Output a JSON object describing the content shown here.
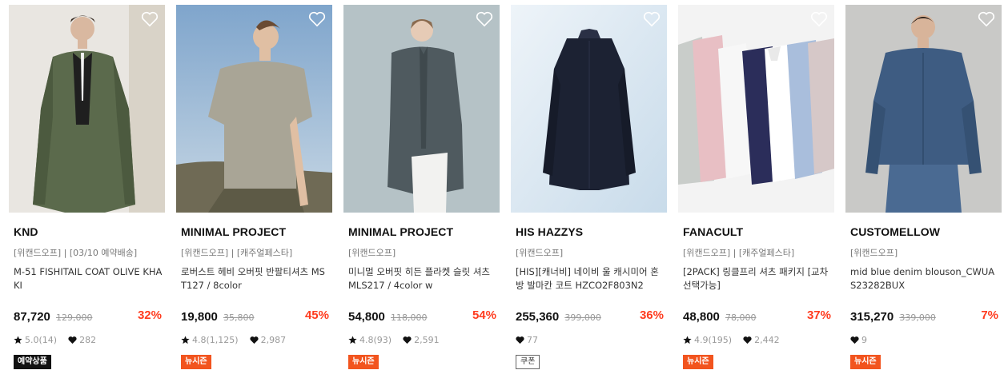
{
  "products": [
    {
      "brand": "KND",
      "tags": "[위캔드오프] | [03/10 예약배송]",
      "name": "M-51 FISHITAIL COAT OLIVE KHAKI",
      "price": "87,720",
      "original_price": "129,000",
      "discount": "32%",
      "rating": "5.0(14)",
      "likes": "282",
      "badge": "예약상품",
      "badge_style": "black",
      "bg_color": "#e9e6e1",
      "garment_color": "#5b6a4c"
    },
    {
      "brand": "MINIMAL PROJECT",
      "tags": "[위캔드오프] | [캐주얼페스타]",
      "name": "로버스트 헤비 오버핏 반팔티셔츠 MST127 / 8color",
      "price": "19,800",
      "original_price": "35,800",
      "discount": "45%",
      "rating": "4.8(1,125)",
      "likes": "2,987",
      "badge": "뉴시즌",
      "badge_style": "orange",
      "bg_color": "#9cb8d2",
      "garment_color": "#a9a596"
    },
    {
      "brand": "MINIMAL PROJECT",
      "tags": "[위캔드오프]",
      "name": "미니멀 오버핏 히든 플라켓 슬릿 셔츠 MLS217 / 4color w",
      "price": "54,800",
      "original_price": "118,000",
      "discount": "54%",
      "rating": "4.8(93)",
      "likes": "2,591",
      "badge": "뉴시즌",
      "badge_style": "orange",
      "bg_color": "#b5c2c6",
      "garment_color": "#4f5a5f"
    },
    {
      "brand": "HIS HAZZYS",
      "tags": "[위캔드오프]",
      "name": "[HIS][캐너비] 네이비 울 캐시미어 혼방 발마칸 코트 HZCO2F803N2",
      "price": "255,360",
      "original_price": "399,000",
      "discount": "36%",
      "rating": "",
      "likes": "77",
      "badge": "쿠폰",
      "badge_style": "outline",
      "bg_color": "#d8e5f0",
      "garment_color": "#1c2233"
    },
    {
      "brand": "FANACULT",
      "tags": "[위캔드오프] | [캐주얼페스타]",
      "name": "[2PACK] 링클프리 셔츠 패키지 [교차선택가능]",
      "price": "48,800",
      "original_price": "78,000",
      "discount": "37%",
      "rating": "4.9(195)",
      "likes": "2,442",
      "badge": "뉴시즌",
      "badge_style": "orange",
      "bg_color": "#f3f3f3",
      "garment_color": "#e8bfc4"
    },
    {
      "brand": "CUSTOMELLOW",
      "tags": "[위캔드오프]",
      "name": "mid blue denim blouson_CWUAS23282BUX",
      "price": "315,270",
      "original_price": "339,000",
      "discount": "7%",
      "rating": "",
      "likes": "9",
      "badge": "뉴시즌",
      "badge_style": "orange",
      "bg_color": "#c9c9c7",
      "garment_color": "#3e5c82"
    }
  ]
}
